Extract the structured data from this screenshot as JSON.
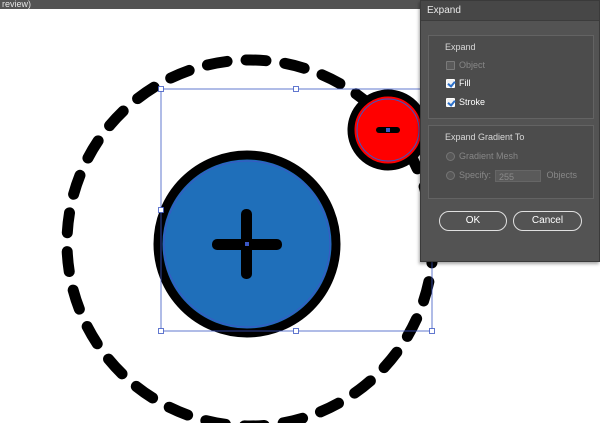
{
  "window": {
    "tab_label": "review)"
  },
  "dialog": {
    "title": "Expand",
    "expand_group": {
      "label": "Expand",
      "object": {
        "label": "Object",
        "checked": false,
        "enabled": false
      },
      "fill": {
        "label": "Fill",
        "checked": true,
        "enabled": true
      },
      "stroke": {
        "label": "Stroke",
        "checked": true,
        "enabled": true
      }
    },
    "gradient_group": {
      "label": "Expand Gradient To",
      "gradient_mesh": {
        "label": "Gradient Mesh",
        "enabled": false
      },
      "specify": {
        "label": "Specify:",
        "value": "255",
        "unit": "Objects",
        "enabled": false
      }
    },
    "ok_label": "OK",
    "cancel_label": "Cancel"
  },
  "colors": {
    "blue_circle": "#1f6fba",
    "red_circle": "#ff0000",
    "stroke": "#000000",
    "selection": "#3b57c4",
    "dialog_bg": "#535353"
  }
}
